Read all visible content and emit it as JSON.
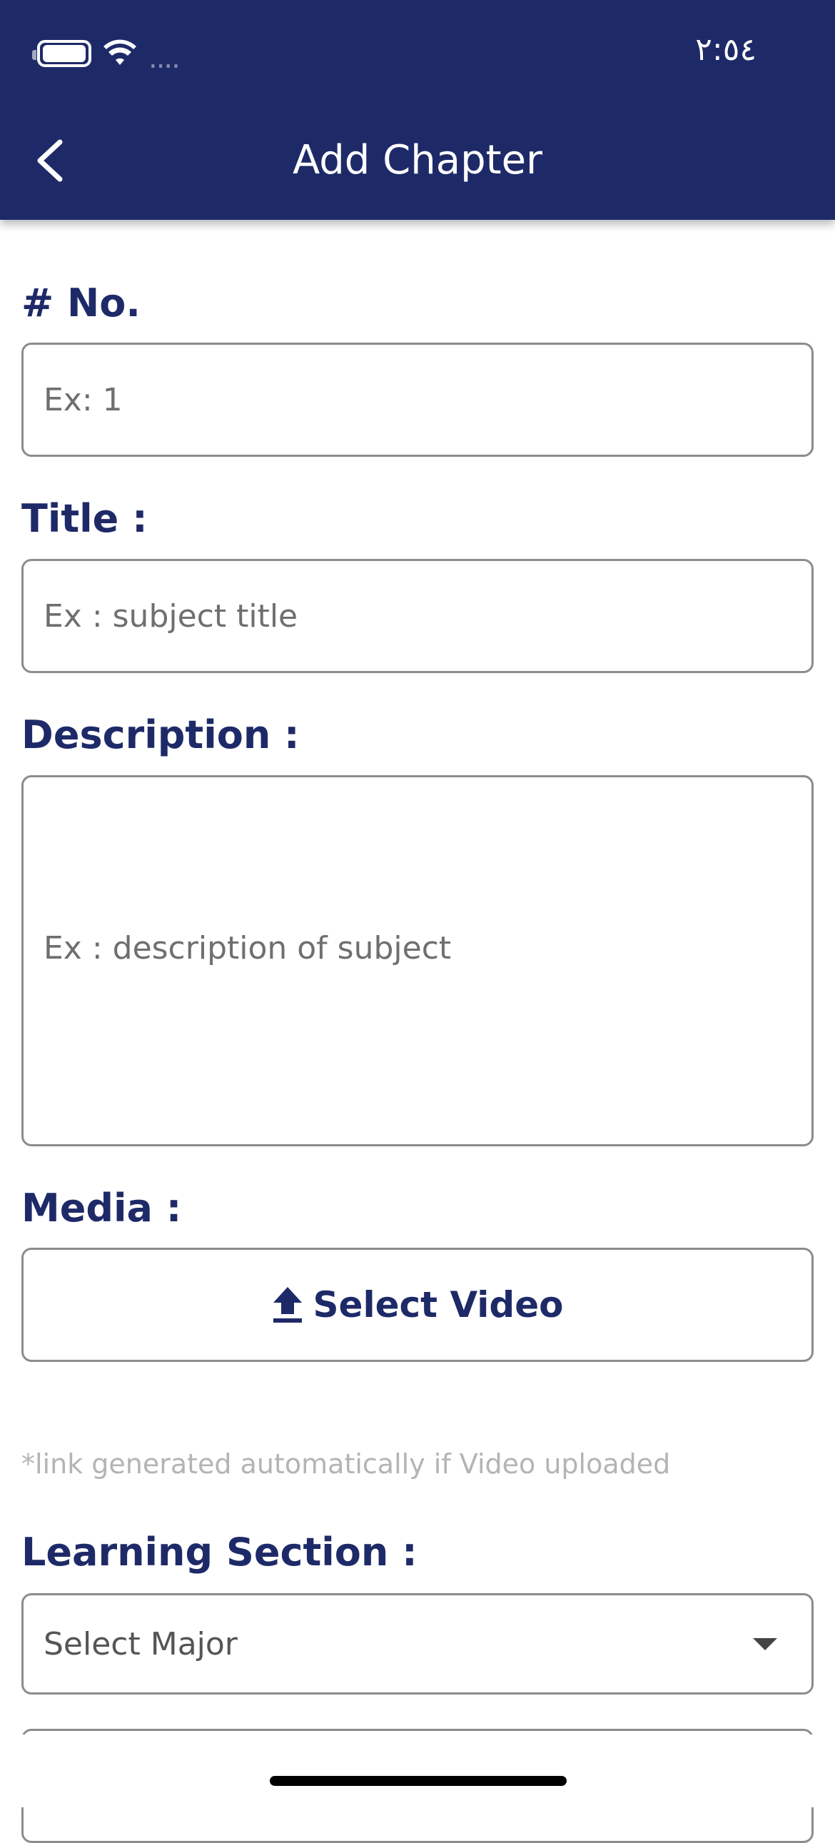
{
  "status_bar": {
    "time": "٢:٥٤",
    "signal": "...."
  },
  "header": {
    "title": "Add Chapter",
    "background": "#1e2a68"
  },
  "form": {
    "number": {
      "label": "# No.",
      "placeholder": "Ex: 1"
    },
    "title": {
      "label": "Title :",
      "placeholder": "Ex : subject title"
    },
    "description": {
      "label": "Description :",
      "placeholder": "Ex : description of subject"
    },
    "media": {
      "label": "Media :",
      "button_label": "Select Video",
      "hint": "*link generated automatically if Video uploaded"
    },
    "learning_section": {
      "label": "Learning Section :",
      "selected": "Select Major"
    }
  },
  "colors": {
    "accent": "#1e2a68",
    "border": "#8c8c8c",
    "hint": "#b4b4b4"
  },
  "icons": [
    "battery-icon",
    "wifi-icon",
    "back-chevron-icon",
    "upload-icon",
    "caret-down-icon"
  ]
}
